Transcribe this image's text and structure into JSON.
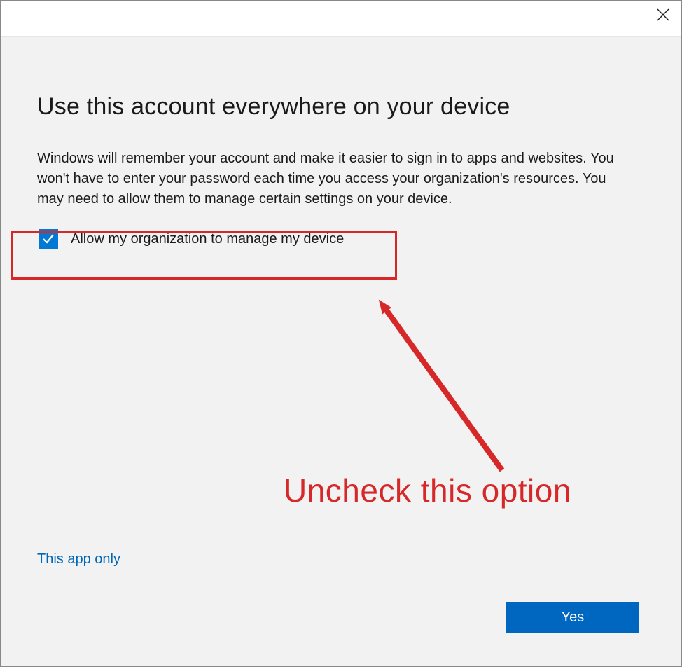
{
  "titlebar": {
    "close_icon": "close-icon"
  },
  "dialog": {
    "heading": "Use this account everywhere on your device",
    "body": "Windows will remember your account and make it easier to sign in to apps and websites. You won't have to enter your password each time you access your organization's resources. You may need to allow them to manage certain settings on your device.",
    "checkbox": {
      "checked": true,
      "label": "Allow my organization to manage my device"
    },
    "link": "This app only",
    "primary_button": "Yes"
  },
  "annotation": {
    "text": "Uncheck this option",
    "highlight_color": "#d62828"
  },
  "colors": {
    "accent": "#0078d4",
    "button": "#0067c0",
    "link": "#0067b8",
    "annotation": "#d62828"
  }
}
